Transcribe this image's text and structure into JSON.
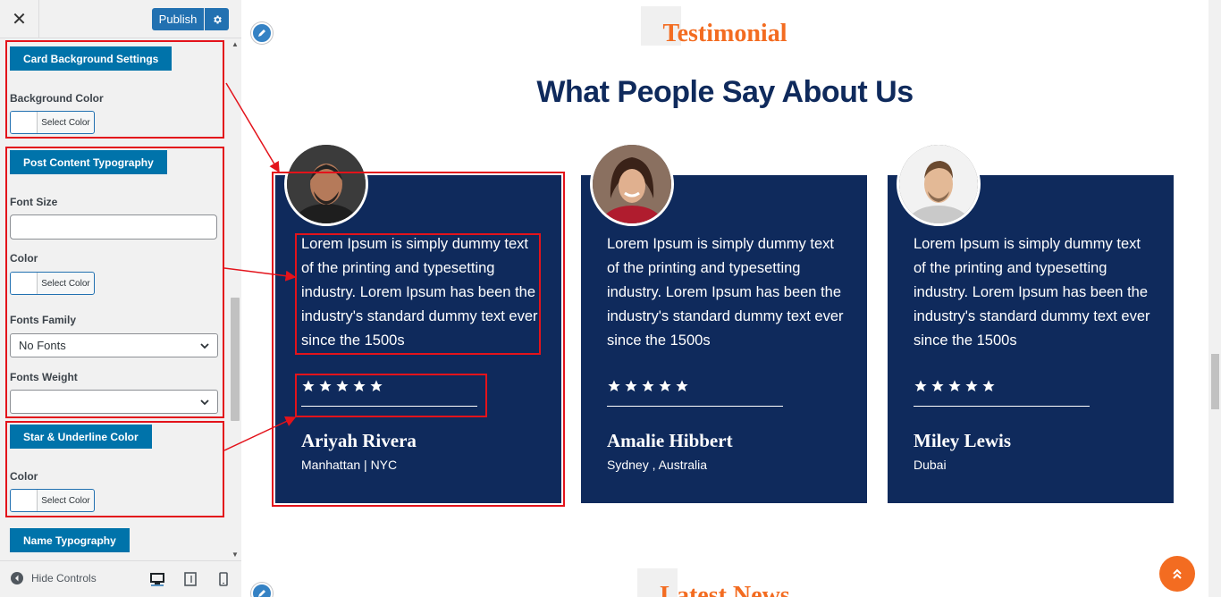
{
  "customizer": {
    "close_icon": "close-icon",
    "publish_label": "Publish",
    "sections": {
      "card_background": {
        "title": "Card Background Settings",
        "background_color_label": "Background Color",
        "select_color_label": "Select Color"
      },
      "post_content_typography": {
        "title": "Post Content Typography",
        "font_size_label": "Font Size",
        "font_size_value": "",
        "color_label": "Color",
        "select_color_label": "Select Color",
        "fonts_family_label": "Fonts Family",
        "fonts_family_value": "No Fonts",
        "fonts_weight_label": "Fonts Weight",
        "fonts_weight_value": ""
      },
      "star_underline": {
        "title": "Star & Underline Color",
        "color_label": "Color",
        "select_color_label": "Select Color"
      },
      "name_typography": {
        "title": "Name Typography"
      }
    },
    "footer": {
      "hide_controls_label": "Hide Controls",
      "devices": [
        "desktop-icon",
        "tablet-icon",
        "mobile-icon"
      ]
    },
    "colors": {
      "section_button": "#0073aa",
      "publish": "#2271b1",
      "annotation": "#e3131b"
    }
  },
  "preview": {
    "section_label": "Testimonial",
    "section_title": "What People Say About Us",
    "next_section_label": "Latest News",
    "testimonials": [
      {
        "text": "Lorem Ipsum is simply dummy text of the printing and typesetting industry. Lorem Ipsum has been the industry's standard dummy text ever since the 1500s",
        "rating": 5,
        "name": "Ariyah Rivera",
        "location": "Manhattan | NYC"
      },
      {
        "text": "Lorem Ipsum is simply dummy text of the printing and typesetting industry. Lorem Ipsum has been the industry's standard dummy text ever since the 1500s",
        "rating": 5,
        "name": "Amalie Hibbert",
        "location": "Sydney , Australia"
      },
      {
        "text": "Lorem Ipsum is simply dummy text of the printing and typesetting industry. Lorem Ipsum has been the industry's standard dummy text ever since the 1500s",
        "rating": 5,
        "name": "Miley Lewis",
        "location": "Dubai"
      }
    ],
    "colors": {
      "card_bg": "#0f2a5c",
      "accent": "#f36c21",
      "title": "#0f2a5c"
    }
  }
}
